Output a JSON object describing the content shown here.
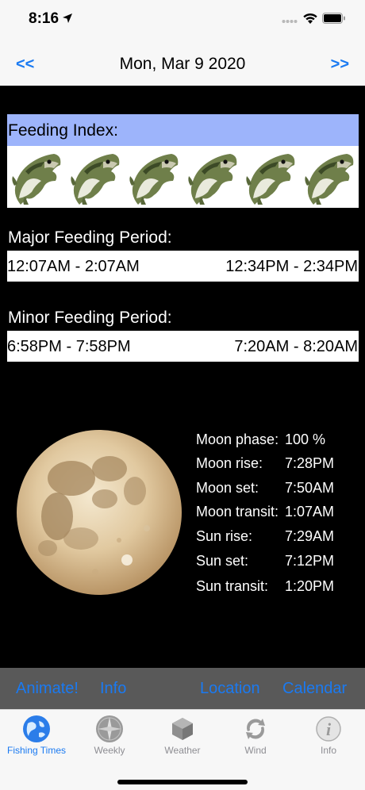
{
  "status": {
    "time": "8:16"
  },
  "nav": {
    "prev": "<<",
    "title": "Mon, Mar 9 2020",
    "next": ">>"
  },
  "feeding_index": {
    "label": "Feeding Index:",
    "fish_count": 6,
    "icon": "bass-fish-icon"
  },
  "major": {
    "label": "Major Feeding Period:",
    "period1": "12:07AM - 2:07AM",
    "period2": "12:34PM - 2:34PM"
  },
  "minor": {
    "label": "Minor Feeding Period:",
    "period1": "6:58PM - 7:58PM",
    "period2": "7:20AM - 8:20AM"
  },
  "moon": {
    "phase_label": "Moon phase:",
    "phase_value": "100 %",
    "rise_label": "Moon rise:",
    "rise_value": "7:28PM",
    "set_label": "Moon set:",
    "set_value": "7:50AM",
    "transit_label": "Moon transit:",
    "transit_value": "1:07AM",
    "sunrise_label": "Sun rise:",
    "sunrise_value": "7:29AM",
    "sunset_label": "Sun set:",
    "sunset_value": "7:12PM",
    "suntransit_label": "Sun transit:",
    "suntransit_value": "1:20PM"
  },
  "toolbar": {
    "animate": "Animate!",
    "info": "Info",
    "location": "Location",
    "calendar": "Calendar"
  },
  "tabs": [
    {
      "label": "Fishing Times",
      "icon": "globe-icon",
      "active": true
    },
    {
      "label": "Weekly",
      "icon": "compass-icon",
      "active": false
    },
    {
      "label": "Weather",
      "icon": "cube-icon",
      "active": false
    },
    {
      "label": "Wind",
      "icon": "wind-arrows-icon",
      "active": false
    },
    {
      "label": "Info",
      "icon": "info-icon",
      "active": false
    }
  ],
  "colors": {
    "accent": "#1a7af2",
    "index_header": "#9db4fb",
    "toolbar": "#595959",
    "content_bg": "#000000"
  }
}
